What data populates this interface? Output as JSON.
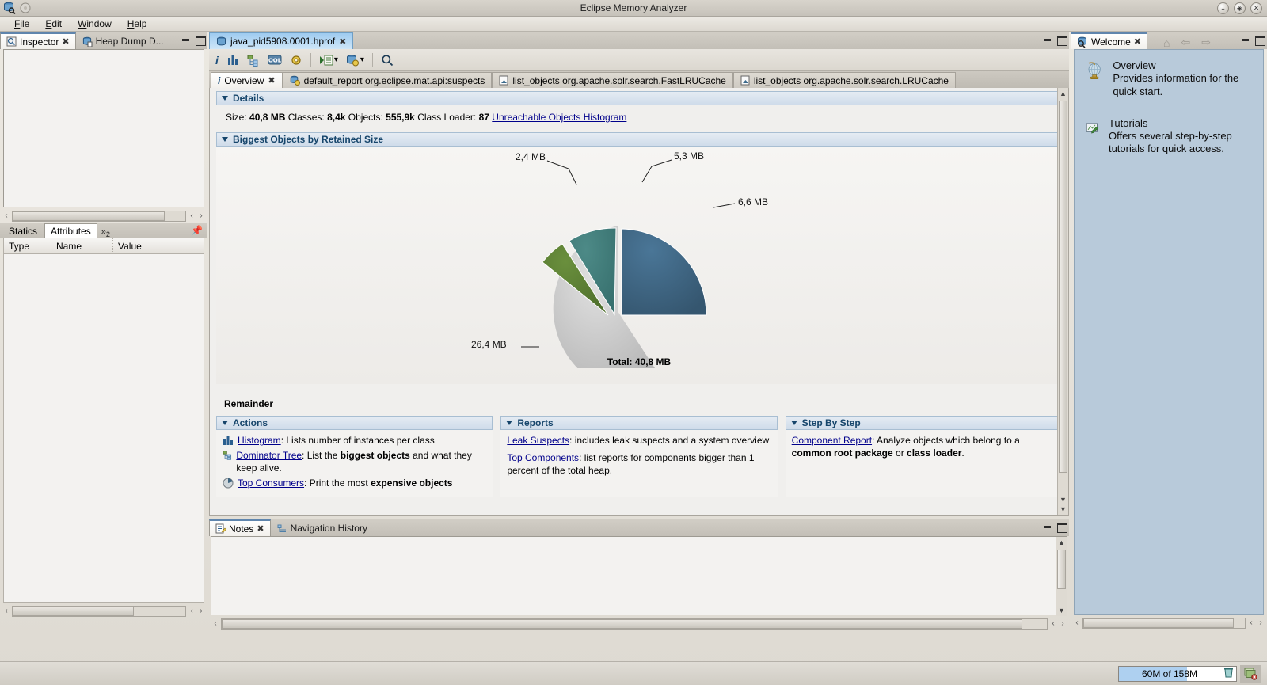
{
  "window": {
    "title": "Eclipse Memory Analyzer",
    "buttons": [
      "minimize",
      "restore",
      "close"
    ]
  },
  "menu": {
    "items": [
      "File",
      "Edit",
      "Window",
      "Help"
    ]
  },
  "inspector": {
    "tabs": [
      {
        "label": "Inspector",
        "icon": "inspector-icon",
        "active": true,
        "closable": true
      },
      {
        "label": "Heap Dump D...",
        "icon": "heap-dump-icon",
        "active": false,
        "closable": false
      }
    ],
    "subtabs": [
      {
        "label": "Statics",
        "selected": false
      },
      {
        "label": "Attributes",
        "selected": true
      }
    ],
    "overflow_label": "»",
    "overflow_count": "2",
    "columns": [
      "Type",
      "Name",
      "Value"
    ],
    "rows": []
  },
  "editor": {
    "tab": {
      "label": "java_pid5908.0001.hprof",
      "icon": "heap-dump-icon"
    },
    "toolbar": [
      {
        "name": "overview-info-icon",
        "glyph": "i"
      },
      {
        "name": "histogram-icon",
        "glyph": "bars"
      },
      {
        "name": "dominator-tree-icon",
        "glyph": "tree"
      },
      {
        "name": "oql-icon",
        "glyph": "OQL"
      },
      {
        "name": "inspections-gear-icon",
        "glyph": "gear"
      },
      {
        "name": "run-query-icon",
        "glyph": "query"
      },
      {
        "name": "run-report-icon",
        "glyph": "report"
      },
      {
        "name": "search-icon",
        "glyph": "search"
      }
    ],
    "inner_tabs": [
      {
        "label": "Overview",
        "icon": "info-icon",
        "active": true,
        "closable": true
      },
      {
        "label": "default_report org.eclipse.mat.api:suspects",
        "icon": "report-icon",
        "active": false,
        "closable": false
      },
      {
        "label": "list_objects org.apache.solr.search.FastLRUCache",
        "icon": "page-icon",
        "active": false,
        "closable": false
      },
      {
        "label": "list_objects org.apache.solr.search.LRUCache",
        "icon": "page-icon",
        "active": false,
        "closable": false
      }
    ]
  },
  "details": {
    "header": "Details",
    "size_label": "Size:",
    "size_value": "40,8 MB",
    "classes_label": "Classes:",
    "classes_value": "8,4k",
    "objects_label": "Objects:",
    "objects_value": "555,9k",
    "classloader_label": "Class Loader:",
    "classloader_value": "87",
    "link": "Unreachable Objects Histogram"
  },
  "biggest_objects": {
    "header": "Biggest Objects by Retained Size",
    "remainder_label": "Remainder",
    "total_label": "Total: 40,8 MB"
  },
  "chart_data": {
    "type": "pie",
    "title": "Biggest Objects by Retained Size",
    "unit": "MB",
    "total": 40.8,
    "total_label": "Total: 40,8 MB",
    "labels": [
      "5,3 MB",
      "2,4 MB",
      "6,6 MB",
      "26,4 MB"
    ],
    "slices": [
      {
        "label": "6,6 MB",
        "value": 6.6,
        "color": "#3c6480",
        "exploded": true,
        "start_deg": 0,
        "sweep_deg": 58.2
      },
      {
        "label": "5,3 MB",
        "value": 5.3,
        "color": "#407a78",
        "exploded": true,
        "start_deg": 58.2,
        "sweep_deg": 46.8
      },
      {
        "label": "2,4 MB",
        "value": 2.4,
        "color": "#5a7d32",
        "exploded": true,
        "start_deg": 105.0,
        "sweep_deg": 21.2
      },
      {
        "label": "26,4 MB",
        "value": 26.4,
        "color": "#bfbfbf",
        "exploded": false,
        "start_deg": 126.2,
        "sweep_deg": 232.9
      }
    ],
    "legend": "none",
    "grid": false
  },
  "actions": {
    "header": "Actions",
    "items": [
      {
        "icon": "histogram-icon",
        "link": "Histogram",
        "rest": ": Lists number of instances per class"
      },
      {
        "icon": "dominator-tree-icon",
        "link": "Dominator Tree",
        "rest": ": List the ",
        "bold": "biggest objects",
        "rest2": " and what they keep alive."
      },
      {
        "icon": "top-consumers-icon",
        "link": "Top Consumers",
        "rest": ": Print the most ",
        "bold": "expensive objects",
        "rest2": ""
      }
    ]
  },
  "reports": {
    "header": "Reports",
    "items": [
      {
        "link": "Leak Suspects",
        "rest": ": includes leak suspects and a system overview"
      },
      {
        "link": "Top Components",
        "rest": ": list reports for components bigger than 1 percent of the total heap."
      }
    ]
  },
  "stepbystep": {
    "header": "Step By Step",
    "items": [
      {
        "link": "Component Report",
        "rest": ": Analyze objects which belong to a ",
        "bold": "common root package",
        "mid": " or ",
        "bold2": "class loader",
        "tail": "."
      }
    ]
  },
  "bottom_view": {
    "tabs": [
      {
        "label": "Notes",
        "icon": "notes-icon",
        "active": true,
        "closable": true
      },
      {
        "label": "Navigation History",
        "icon": "navigation-history-icon",
        "active": false,
        "closable": false
      }
    ]
  },
  "welcome": {
    "tab": {
      "label": "Welcome",
      "icon": "welcome-icon"
    },
    "toolbar": [
      {
        "name": "home-icon",
        "glyph": "⌂"
      },
      {
        "name": "back-arrow-icon",
        "glyph": "⇦"
      },
      {
        "name": "forward-arrow-icon",
        "glyph": "⇨"
      }
    ],
    "items": [
      {
        "icon": "globe-icon",
        "title": "Overview",
        "desc": "Provides information for the quick start."
      },
      {
        "icon": "tutorials-icon",
        "title": "Tutorials",
        "desc": "Offers several step-by-step tutorials for quick access."
      }
    ]
  },
  "status": {
    "heap": "60M of 158M",
    "trash_icon": "trash-icon",
    "error_log_icon": "error-log-icon"
  },
  "colors": {
    "accent_blue": "#16456b",
    "link": "#00008b",
    "tab_active": "#9ecbf0",
    "welcome_bg": "#b8cada",
    "heap_fill": "#aed0f0"
  }
}
